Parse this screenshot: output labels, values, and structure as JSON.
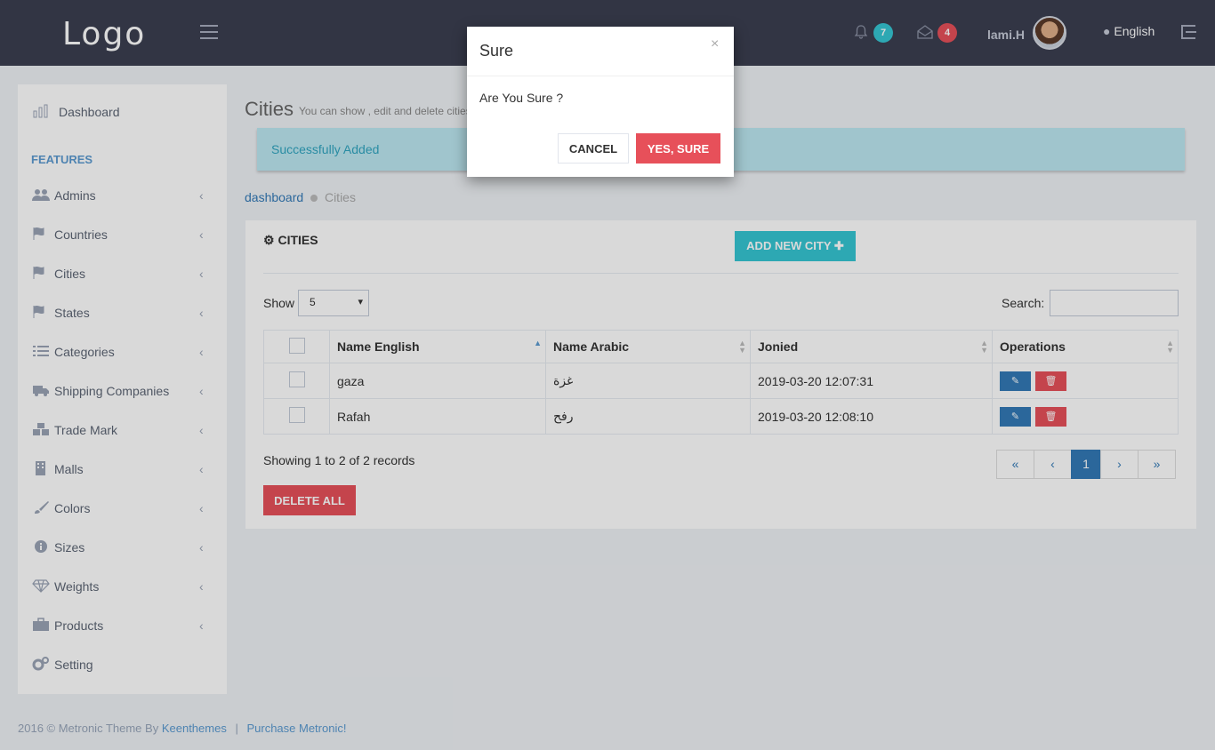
{
  "header": {
    "logo": "Logo",
    "notifications_count": "7",
    "messages_count": "4",
    "username": "lami.H",
    "language": "English",
    "colors": {
      "notif_badge": "#36c6d3",
      "msg_badge": "#e7505a",
      "topbar": "#3b3f51"
    }
  },
  "sidebar": {
    "dashboard": "Dashboard",
    "heading": "FEATURES",
    "items": [
      {
        "label": "Admins",
        "icon": "users-icon"
      },
      {
        "label": "Countries",
        "icon": "flag-icon"
      },
      {
        "label": "Cities",
        "icon": "flag-icon"
      },
      {
        "label": "States",
        "icon": "flag-icon"
      },
      {
        "label": "Categories",
        "icon": "list-icon"
      },
      {
        "label": "Shipping Companies",
        "icon": "truck-icon"
      },
      {
        "label": "Trade Mark",
        "icon": "cubes-icon"
      },
      {
        "label": "Malls",
        "icon": "building-icon"
      },
      {
        "label": "Colors",
        "icon": "brush-icon"
      },
      {
        "label": "Sizes",
        "icon": "info-icon"
      },
      {
        "label": "Weights",
        "icon": "diamond-icon"
      },
      {
        "label": "Products",
        "icon": "briefcase-icon"
      }
    ],
    "setting": "Setting"
  },
  "page": {
    "title": "Cities",
    "subtitle": "You can show , edit and delete cities",
    "alert": "Successfully Added",
    "breadcrumb": {
      "home": "dashboard",
      "current": "Cities"
    }
  },
  "portlet": {
    "title": "CITIES",
    "add_button": "ADD NEW CITY",
    "show_label": "Show",
    "show_value": "5",
    "search_label": "Search:",
    "columns": [
      "Name English",
      "Name Arabic",
      "Jonied",
      "Operations"
    ],
    "rows": [
      {
        "name_en": "gaza",
        "name_ar": "غزة",
        "joined": "2019-03-20 12:07:31"
      },
      {
        "name_en": "Rafah",
        "name_ar": "رفح",
        "joined": "2019-03-20 12:08:10"
      }
    ],
    "records_info": "Showing 1 to 2 of 2 records",
    "pagination": {
      "first": "«",
      "prev": "‹",
      "current": "1",
      "next": "›",
      "last": "»"
    },
    "delete_all": "DELETE ALL"
  },
  "footer": {
    "text": "2016 © Metronic Theme By",
    "author": "Keenthemes",
    "separator": "|",
    "purchase": "Purchase Metronic!"
  },
  "modal": {
    "title": "Sure",
    "close": "×",
    "body": "Are You Sure ?",
    "cancel": "CANCEL",
    "confirm": "YES, SURE"
  }
}
